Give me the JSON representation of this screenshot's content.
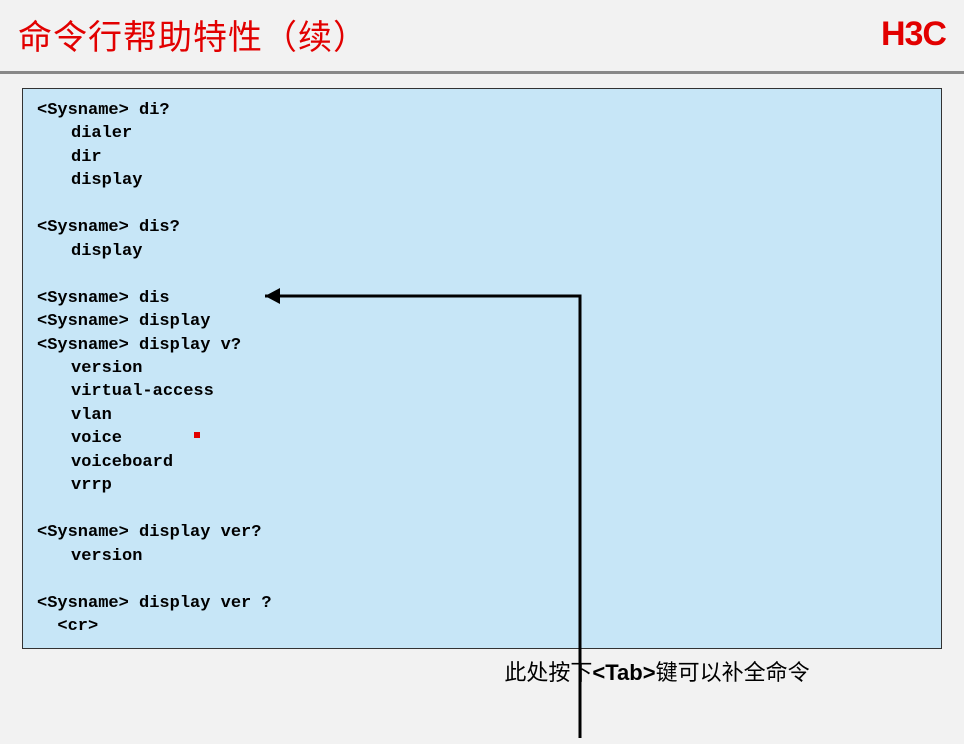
{
  "header": {
    "title": "命令行帮助特性（续）",
    "logo": "H3C"
  },
  "terminal": {
    "lines": [
      {
        "type": "cmd",
        "text": "<Sysname> di?"
      },
      {
        "type": "indent",
        "text": "dialer"
      },
      {
        "type": "indent",
        "text": "dir"
      },
      {
        "type": "indent",
        "text": "display"
      },
      {
        "type": "blank"
      },
      {
        "type": "cmd",
        "text": "<Sysname> dis?"
      },
      {
        "type": "indent",
        "text": "display"
      },
      {
        "type": "blank"
      },
      {
        "type": "cmd",
        "text": "<Sysname> dis"
      },
      {
        "type": "cmd",
        "text": "<Sysname> display"
      },
      {
        "type": "cmd",
        "text": "<Sysname> display v?"
      },
      {
        "type": "indent",
        "text": "version"
      },
      {
        "type": "indent",
        "text": "virtual-access"
      },
      {
        "type": "indent",
        "text": "vlan"
      },
      {
        "type": "indent-dot",
        "text": "voice"
      },
      {
        "type": "indent",
        "text": "voiceboard"
      },
      {
        "type": "indent",
        "text": "vrrp"
      },
      {
        "type": "blank"
      },
      {
        "type": "cmd",
        "text": "<Sysname> display ver?"
      },
      {
        "type": "indent",
        "text": "version"
      },
      {
        "type": "blank"
      },
      {
        "type": "cmd",
        "text": "<Sysname> display ver ?"
      },
      {
        "type": "cr",
        "text": "  <cr>"
      }
    ]
  },
  "caption": {
    "prefix": "此处按下",
    "key": "<Tab>",
    "suffix": "键可以补全命令"
  }
}
